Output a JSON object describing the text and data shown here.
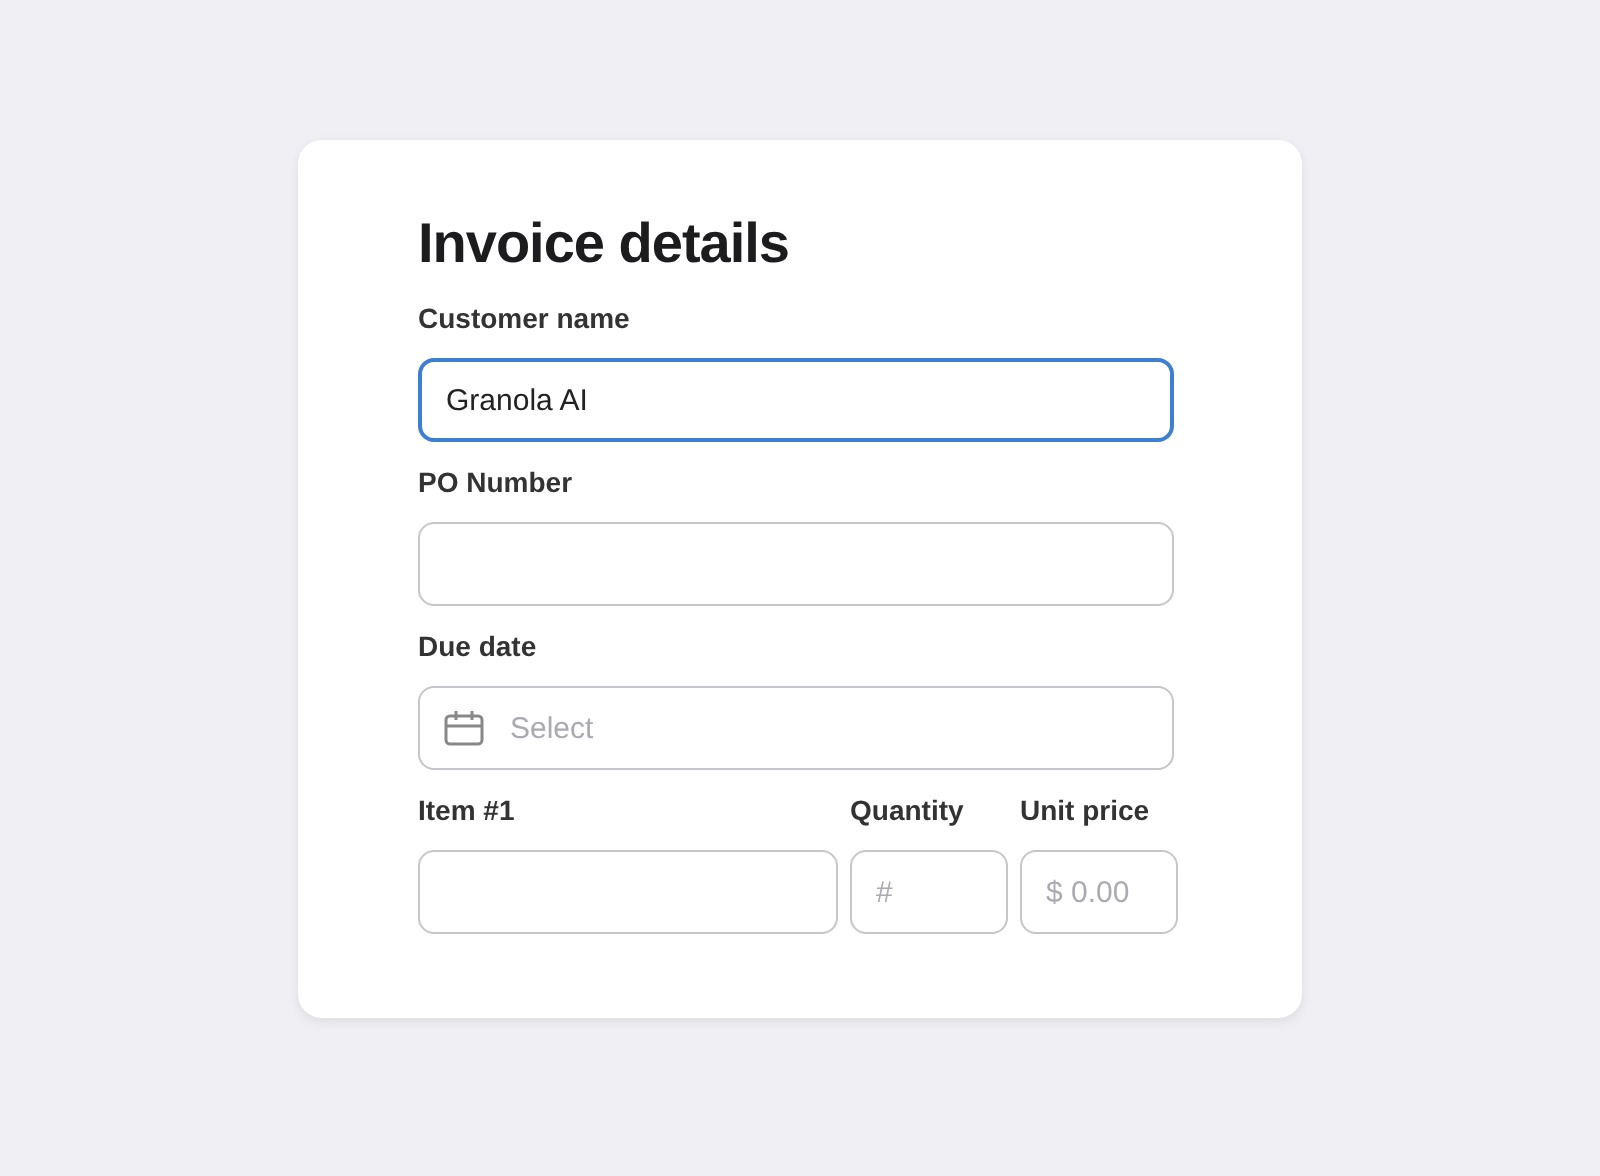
{
  "title": "Invoice details",
  "fields": [
    {
      "kind": "text",
      "label": "Customer name",
      "value": "Granola AI",
      "focused": true
    },
    {
      "kind": "text",
      "label": "PO Number",
      "focused": false
    },
    {
      "kind": "date",
      "label": "Due date",
      "placeholder": "Select",
      "focused": false
    }
  ],
  "item_row": [
    {
      "label": "Item #1",
      "focused": false
    },
    {
      "label": "Quantity",
      "placeholder": "#",
      "focused": false
    },
    {
      "label": "Unit price",
      "placeholder": "$ 0.00",
      "focused": false
    }
  ]
}
